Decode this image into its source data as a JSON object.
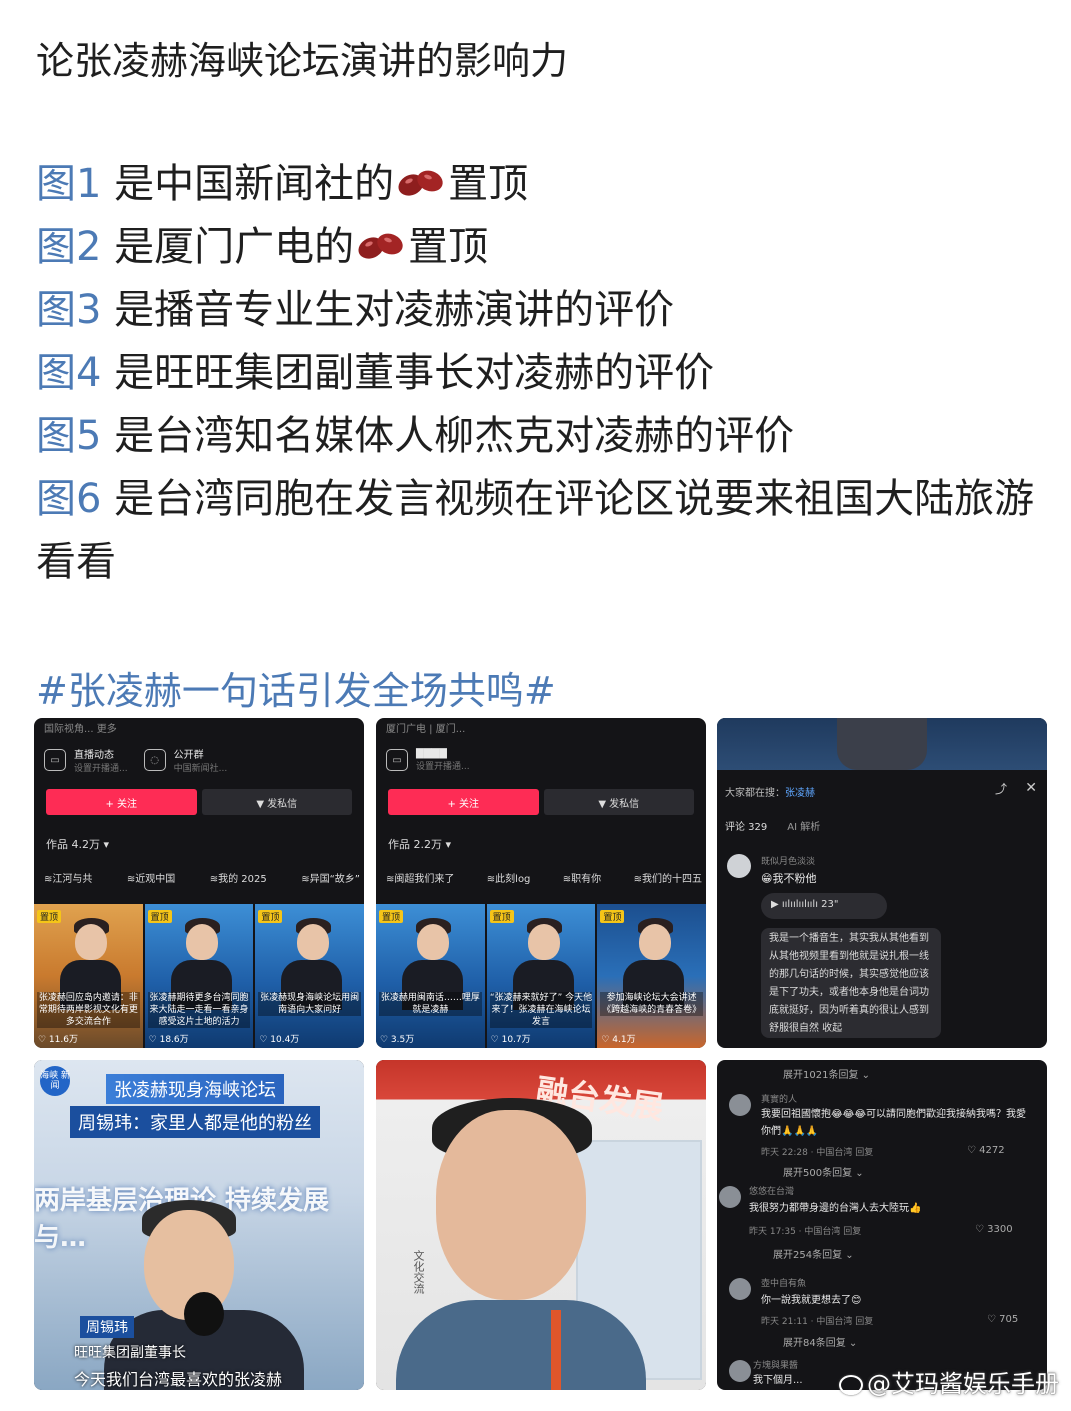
{
  "post": {
    "title": "论张凌赫海峡论坛演讲的影响力",
    "figures": [
      {
        "tag": "图1",
        "text_a": " 是中国新闻社的",
        "text_b": "置顶",
        "bean": true
      },
      {
        "tag": "图2",
        "text_a": " 是厦门广电的",
        "text_b": "置顶",
        "bean": true
      },
      {
        "tag": "图3",
        "text_a": " 是播音专业生对凌赫演讲的评价",
        "text_b": "",
        "bean": false
      },
      {
        "tag": "图4",
        "text_a": " 是旺旺集团副董事长对凌赫的评价",
        "text_b": "",
        "bean": false
      },
      {
        "tag": "图5",
        "text_a": " 是台湾知名媒体人柳杰克对凌赫的评价",
        "text_b": "",
        "bean": false
      },
      {
        "tag": "图6",
        "text_a": " 是台湾同胞在发言视频在评论区说要来祖国大陆旅游看看",
        "text_b": "",
        "bean": false
      }
    ],
    "hashtag": "#张凌赫一句话引发全场共鸣#",
    "bean_icon": "red-bean-emoji",
    "link_color": "#4c7ab5"
  },
  "tile1": {
    "top_text": "国际视角... 更多",
    "chip1_title": "直播动态",
    "chip1_sub": "设置开播通...",
    "chip2_title": "公开群",
    "chip2_sub": "中国新闻社...",
    "follow": "+ 关注",
    "message": "▼ 发私信",
    "works": "作品 4.2万 ▾",
    "collections": [
      "≋江河与共",
      "≋近观中国",
      "≋我的 2025",
      "≋异国“故乡”"
    ],
    "videos": [
      {
        "pin": "置顶",
        "caption": "张凌赫回应岛内邀请：非常期待两岸影视文化有更多交流合作",
        "likes": "♡ 11.6万"
      },
      {
        "pin": "置顶",
        "caption": "张凌赫期待更多台湾同胞来大陆走一走看一看亲身感受这片土地的活力",
        "likes": "♡ 18.6万"
      },
      {
        "pin": "置顶",
        "caption": "张凌赫现身海峡论坛用闽南语向大家问好",
        "likes": "♡ 10.4万"
      }
    ]
  },
  "tile2": {
    "top_text": "厦门广电 | 厦门...",
    "chip1_title": "▇▇▇▇",
    "chip1_sub": "设置开播通...",
    "follow": "+ 关注",
    "message": "▼ 发私信",
    "works": "作品 2.2万 ▾",
    "collections": [
      "≋闽超我们来了",
      "≋此刻log",
      "≋职有你",
      "≋我们的十四五"
    ],
    "videos": [
      {
        "pin": "置顶",
        "caption": "张凌赫用闽南话……哩厚就是凌赫",
        "likes": "♡ 3.5万"
      },
      {
        "pin": "置顶",
        "caption": "“张凌赫来就好了” 今天他来了！张凌赫在海峡论坛发言",
        "likes": "♡ 10.7万"
      },
      {
        "pin": "置顶",
        "caption": "参加海峡论坛大会讲述《跨越海峡的青春答卷》",
        "likes": "♡ 4.1万"
      }
    ]
  },
  "tile3": {
    "search_label": "大家都在搜：",
    "search_term": "张凌赫",
    "tab_comments": "评论 329",
    "tab_ai": "AI 解析",
    "user": "既似月色淡淡",
    "body": "😁我不粉他",
    "voice": "▶ ıılıılıılıılı 23\"",
    "bubble": "我是一个播音生，其实我从其他看到从其他视频里看到他就是说扎根一线的那几句话的时候，其实感觉他应该是下了功夫，或者他本身他是台词功底就挺好，因为听着真的很让人感到舒服很自然 收起"
  },
  "tile4": {
    "logo": "海峡 新闻",
    "title": "张凌赫现身海峡论坛",
    "subtitle": "周锡玮：家里人都是他的粉丝",
    "wall": "两岸基层治理论 持续发展与…",
    "name": "周锡玮",
    "role": "旺旺集团副董事长",
    "quote": "今天我们台湾最喜欢的张凌赫"
  },
  "tile5": {
    "banner": "融台发展",
    "side": "文化交流"
  },
  "tile6": {
    "expand1": "展开1021条回复 ⌄",
    "c1_user": "真實的人",
    "c1_text": "我要回祖國懷抱😂😂😂可以請同胞們歡迎我接納我嗎？我愛你們🙏🙏🙏",
    "c1_meta": "昨天 22:28 · 中国台湾    回复",
    "c1_likes": "♡ 4272",
    "expand2": "展开500条回复 ⌄",
    "c2_user": "悠悠在台灣",
    "c2_text": "我很努力都帶身邊的台灣人去大陸玩👍",
    "c2_meta": "昨天 17:35 · 中国台湾    回复",
    "c2_likes": "♡ 3300",
    "expand3": "展开254条回复 ⌄",
    "c3_user": "壺中自有魚",
    "c3_text": "你一說我就更想去了😊",
    "c3_meta": "昨天 21:11 · 中国台湾    回复",
    "c3_likes": "♡ 705",
    "expand4": "展开84条回复 ⌄",
    "c4_user": "方塊與果醬",
    "c4_text": "我下個月..."
  },
  "watermark": "@艾玛酱娱乐手册"
}
